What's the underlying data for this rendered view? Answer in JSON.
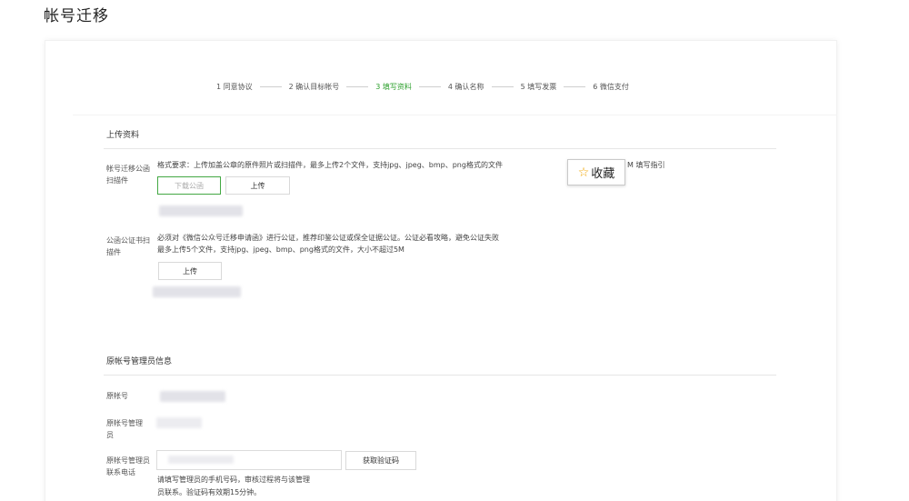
{
  "page": {
    "title": "帐号迁移"
  },
  "steps": [
    {
      "label": "1 同意协议",
      "active": false
    },
    {
      "label": "2 确认目标帐号",
      "active": false
    },
    {
      "label": "3 填写资料",
      "active": true
    },
    {
      "label": "4 确认名称",
      "active": false
    },
    {
      "label": "5 填写发票",
      "active": false
    },
    {
      "label": "6 微信支付",
      "active": false
    }
  ],
  "upload": {
    "section_title": "上传资料",
    "migration": {
      "label": "帐号迁移公函扫描件",
      "desc_prefix": "格式要求：上传加盖公章的原件照片或扫描件，最多上传2个文件，支持jpg、jpeg、bmp、png格式的文件",
      "desc_suffix": "M 填写指引",
      "download_button": "下载公函",
      "upload_button": "上传"
    },
    "notary": {
      "label": "公函公证书扫描件",
      "desc_line1": "必须对《微信公众号迁移申请函》进行公证，推荐印鉴公证或保全证据公证。公证必看攻略，避免公证失败",
      "desc_line2": "最多上传5个文件，支持jpg、jpeg、bmp、png格式的文件，大小不超过5M",
      "upload_button": "上传"
    }
  },
  "favorite": {
    "icon": "star-icon",
    "label": "收藏"
  },
  "admin": {
    "section_title": "原帐号管理员信息",
    "account_label": "原帐号",
    "manager_label": "原帐号管理员",
    "phone_label": "原帐号管理员联系电话",
    "get_code_button": "获取验证码",
    "hint_line1": "请填写管理员的手机号码，审核过程将与该管理",
    "hint_line2": "员联系。验证码有效期15分钟。"
  }
}
